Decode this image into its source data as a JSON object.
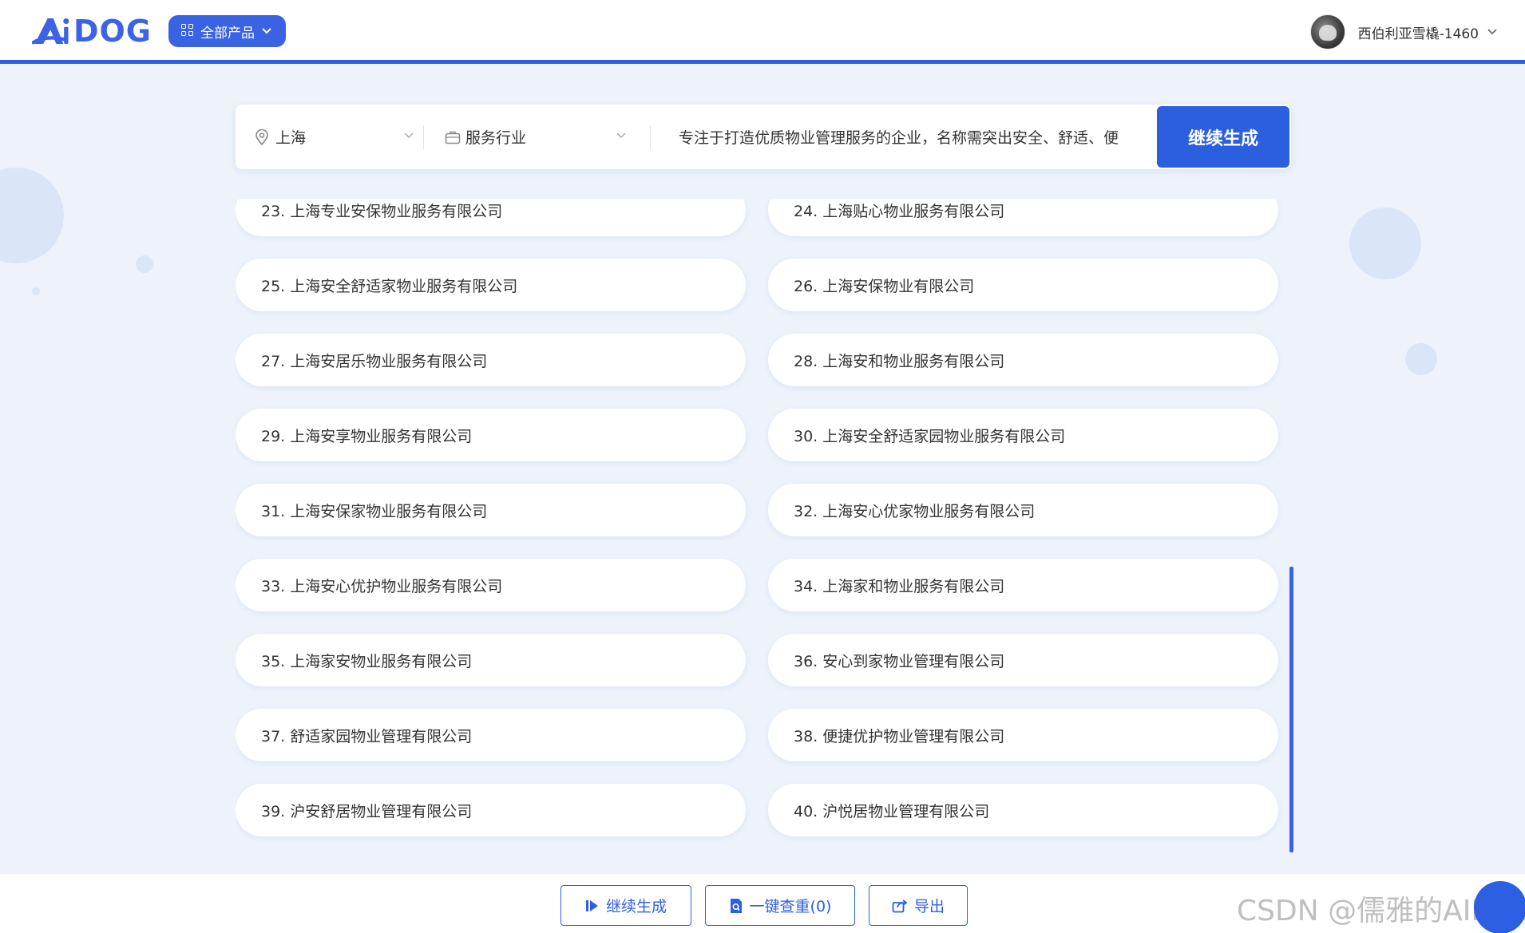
{
  "header": {
    "logo_text": "DOG",
    "all_products_label": "全部产品",
    "user_name": "西伯利亚雪橇-1460"
  },
  "search": {
    "location": "上海",
    "industry": "服务行业",
    "prompt": "专注于打造优质物业管理服务的企业，名称需突出安全、舒适、便",
    "generate_label": "继续生成"
  },
  "results": [
    "23. 上海专业安保物业服务有限公司",
    "24. 上海贴心物业服务有限公司",
    "25. 上海安全舒适家物业服务有限公司",
    "26. 上海安保物业有限公司",
    "27. 上海安居乐物业服务有限公司",
    "28. 上海安和物业服务有限公司",
    "29. 上海安享物业服务有限公司",
    "30. 上海安全舒适家园物业服务有限公司",
    "31. 上海安保家物业服务有限公司",
    "32. 上海安心优家物业服务有限公司",
    "33. 上海安心优护物业服务有限公司",
    "34. 上海家和物业服务有限公司",
    "35. 上海家安物业服务有限公司",
    "36. 安心到家物业管理有限公司",
    "37. 舒适家园物业管理有限公司",
    "38. 便捷优护物业管理有限公司",
    "39. 沪安舒居物业管理有限公司",
    "40. 沪悦居物业管理有限公司"
  ],
  "bottom": {
    "continue_label": "继续生成",
    "check_label": "一键查重(0)",
    "export_label": "导出"
  },
  "watermark": "CSDN @儒雅的AIDOG",
  "colors": {
    "accent": "#2d5fe3",
    "background": "#eef3fb"
  },
  "icons": [
    "grid-icon",
    "chevron-down-icon",
    "location-pin-icon",
    "briefcase-icon",
    "play-icon",
    "document-search-icon",
    "share-icon"
  ]
}
